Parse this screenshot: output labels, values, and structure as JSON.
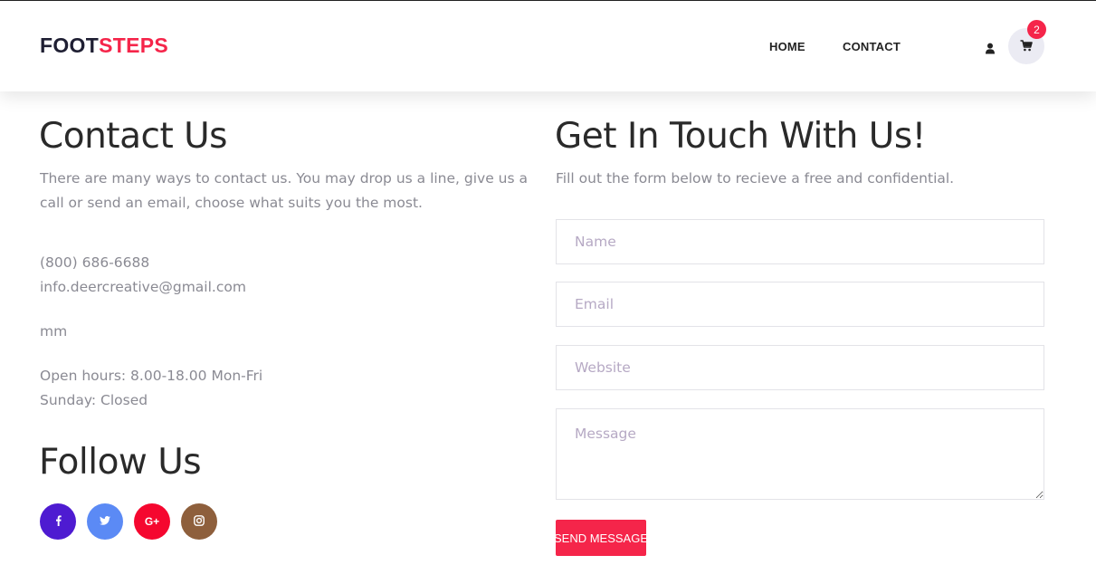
{
  "header": {
    "logo_part1": "FOOT",
    "logo_part2": "STEPS",
    "nav": [
      {
        "label": "HOME"
      },
      {
        "label": "CONTACT"
      }
    ],
    "cart_count": "2",
    "icons": [
      "user-icon",
      "cart-icon"
    ]
  },
  "contact": {
    "title": "Contact Us",
    "intro": "There are many ways to contact us. You may drop us a line, give us a call or send an email, choose what suits you the most.",
    "phone": "(800) 686-6688",
    "email": "info.deercreative@gmail.com",
    "extra": "mm",
    "hours": "Open hours: 8.00-18.00 Mon-Fri",
    "sunday": "Sunday: Closed"
  },
  "follow": {
    "title": "Follow Us",
    "socials": [
      {
        "name": "facebook-icon",
        "glyph": "f",
        "color": "#4e1bd1"
      },
      {
        "name": "twitter-icon",
        "glyph": "🐦",
        "color": "#5b8af5"
      },
      {
        "name": "google-plus-icon",
        "glyph": "G+",
        "color": "#f5072f"
      },
      {
        "name": "instagram-icon",
        "glyph": "◎",
        "color": "#8e5f3c"
      }
    ]
  },
  "form": {
    "title": "Get In Touch With Us!",
    "intro": "Fill out the form below to recieve a free and confidential.",
    "name_placeholder": "Name",
    "email_placeholder": "Email",
    "website_placeholder": "Website",
    "message_placeholder": "Message",
    "submit_label": "SEND MESSAGE"
  },
  "colors": {
    "accent": "#f5254a",
    "logo_dark": "#1f1f33",
    "text_muted": "#8a8a93",
    "placeholder": "#b6a9c4"
  }
}
